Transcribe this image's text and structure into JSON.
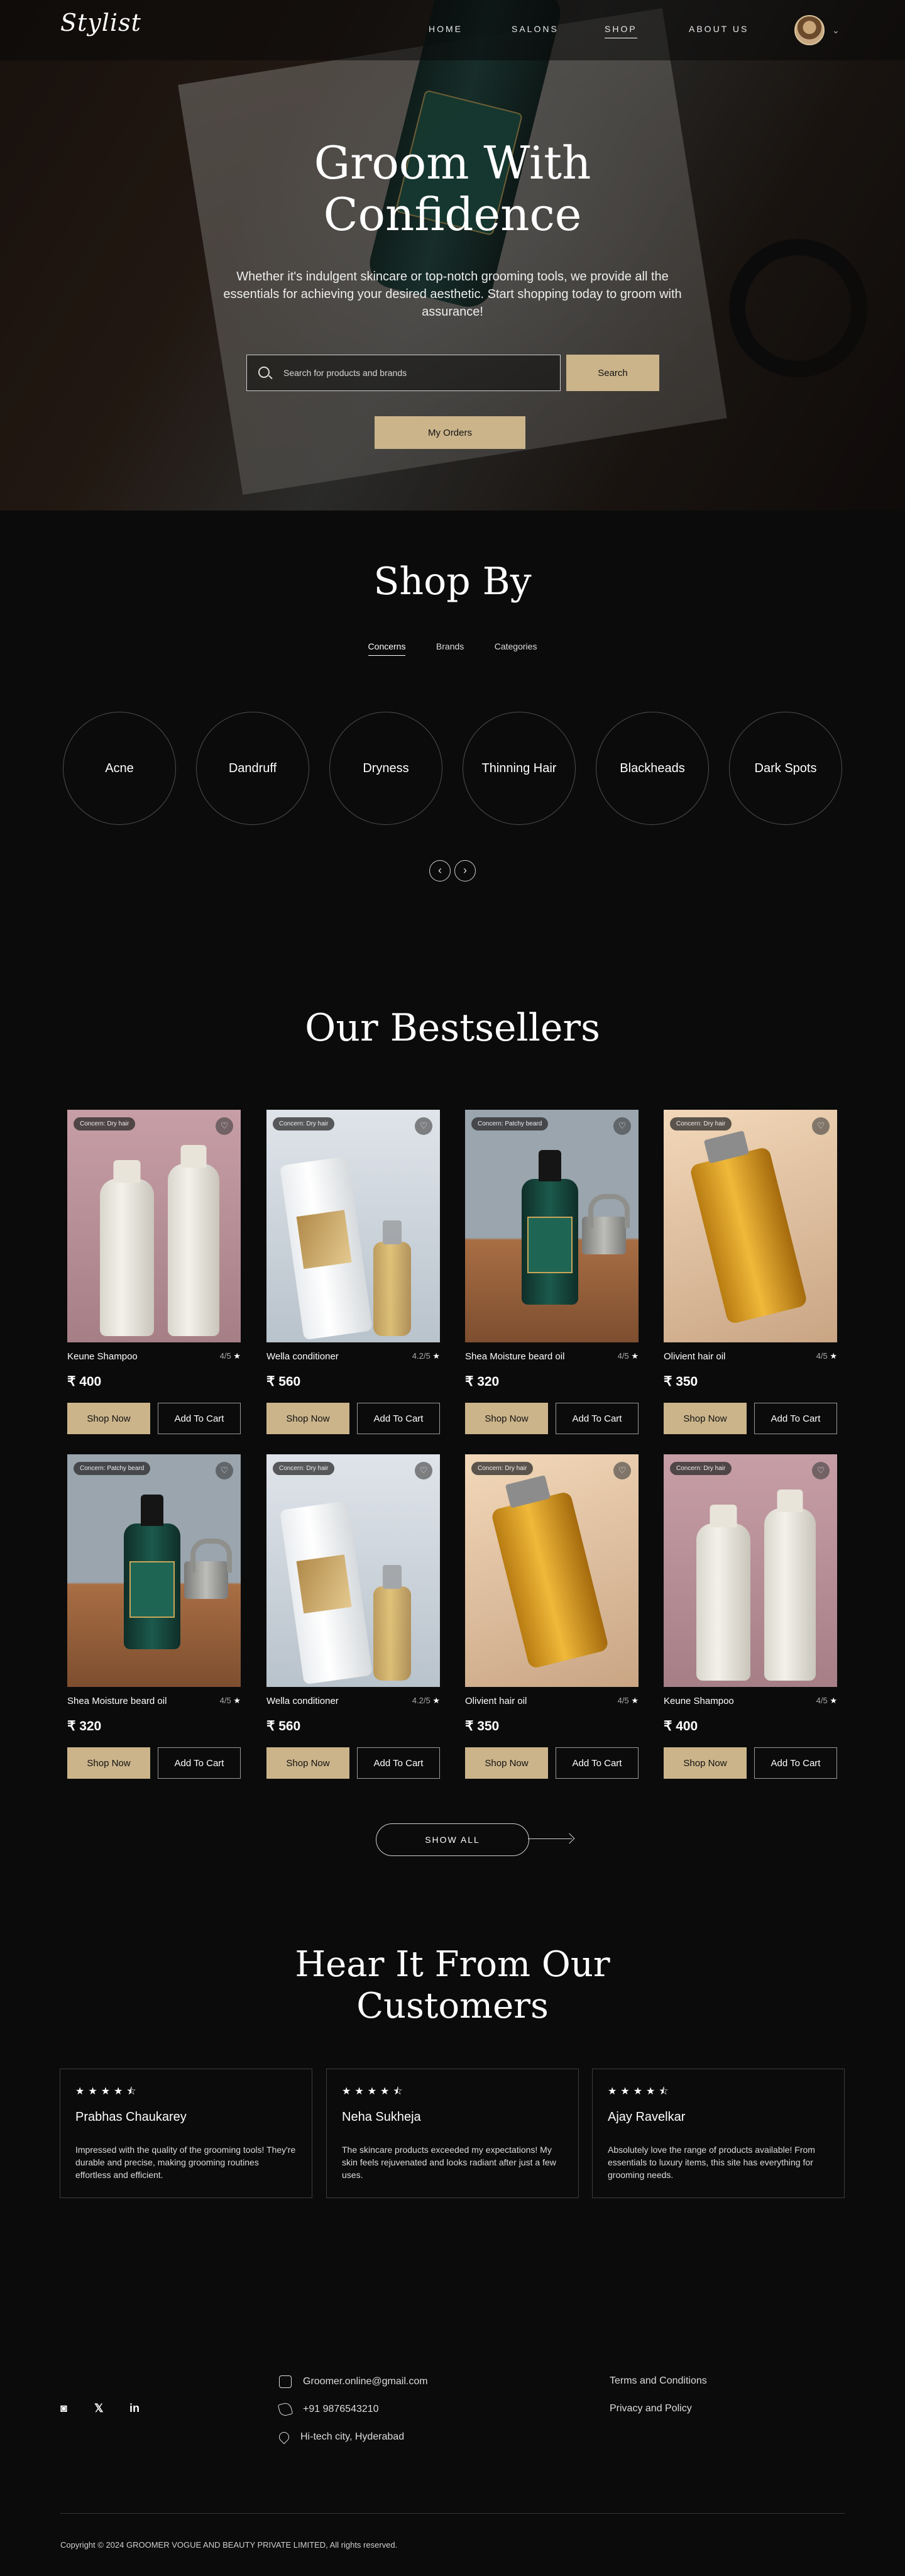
{
  "header": {
    "logo": "Stylist",
    "nav": [
      "HOME",
      "SALONS",
      "SHOP",
      "ABOUT US"
    ]
  },
  "hero": {
    "title_line1": "Groom With",
    "title_line2": "Confidence",
    "subtitle": "Whether it's indulgent skincare or top-notch grooming tools, we provide all the essentials for achieving your desired aesthetic. Start shopping today to groom with assurance!",
    "search_placeholder": "Search for products and brands",
    "search_button": "Search",
    "orders_button": "My Orders"
  },
  "shop_by": {
    "title": "Shop By",
    "tabs": [
      "Concerns",
      "Brands",
      "Categories"
    ],
    "concerns": [
      "Acne",
      "Dandruff",
      "Dryness",
      "Thinning Hair",
      "Blackheads",
      "Dark Spots"
    ],
    "prev_icon": "arrow-left-icon",
    "next_icon": "arrow-right-icon"
  },
  "bestsellers": {
    "title": "Our Bestsellers",
    "products": [
      {
        "tag": "Concern: Dry hair",
        "name": "Keune Shampoo",
        "rating": "4/5",
        "price": "₹ 400",
        "shop": "Shop Now",
        "cart": "Add To Cart"
      },
      {
        "tag": "Concern: Dry hair",
        "name": "Wella conditioner",
        "rating": "4.2/5",
        "price": "₹ 560",
        "shop": "Shop Now",
        "cart": "Add To Cart"
      },
      {
        "tag": "Concern: Patchy beard",
        "name": "Shea Moisture beard oil",
        "rating": "4/5",
        "price": "₹ 320",
        "shop": "Shop Now",
        "cart": "Add To Cart"
      },
      {
        "tag": "Concern: Dry hair",
        "name": "Olivient hair oil",
        "rating": "4/5",
        "price": "₹ 350",
        "shop": "Shop Now",
        "cart": "Add To Cart"
      },
      {
        "tag": "Concern: Patchy beard",
        "name": "Shea Moisture beard oil",
        "rating": "4/5",
        "price": "₹ 320",
        "shop": "Shop Now",
        "cart": "Add To Cart"
      },
      {
        "tag": "Concern: Dry hair",
        "name": "Wella conditioner",
        "rating": "4.2/5",
        "price": "₹ 560",
        "shop": "Shop Now",
        "cart": "Add To Cart"
      },
      {
        "tag": "Concern: Dry hair",
        "name": "Olivient hair oil",
        "rating": "4/5",
        "price": "₹ 350",
        "shop": "Shop Now",
        "cart": "Add To Cart"
      },
      {
        "tag": "Concern: Dry hair",
        "name": "Keune Shampoo",
        "rating": "4/5",
        "price": "₹ 400",
        "shop": "Shop Now",
        "cart": "Add To Cart"
      }
    ],
    "show_all": "SHOW ALL"
  },
  "testimonials": {
    "title_line1": "Hear It From Our",
    "title_line2": "Customers",
    "items": [
      {
        "stars": "★★★★⯪",
        "name": "Prabhas Chaukarey",
        "text": "Impressed with the quality of the grooming tools! They're durable and precise, making grooming routines effortless and efficient."
      },
      {
        "stars": "★★★★⯪",
        "name": "Neha Sukheja",
        "text": "The skincare products exceeded my expectations! My skin feels rejuvenated and looks radiant after just a few uses."
      },
      {
        "stars": "★★★★⯪",
        "name": "Ajay Ravelkar",
        "text": "Absolutely love the range of products available! From essentials to luxury items, this site has everything for grooming needs."
      }
    ]
  },
  "footer": {
    "social": [
      "instagram-icon",
      "x-icon",
      "linkedin-icon"
    ],
    "social_glyphs": [
      "◙",
      "𝕏",
      "in"
    ],
    "email": "Groomer.online@gmail.com",
    "phone": "+91 9876543210",
    "address": "Hi-tech city, Hyderabad",
    "links": [
      "Terms and Conditions",
      "Privacy and Policy"
    ],
    "copyright": "Copyright  ©  2024 GROOMER VOGUE AND BEAUTY PRIVATE LIMITED,  All rights reserved."
  },
  "colors": {
    "background": "#0b0b0b",
    "accent": "#cbb48a",
    "border": "#3d3d3d"
  }
}
